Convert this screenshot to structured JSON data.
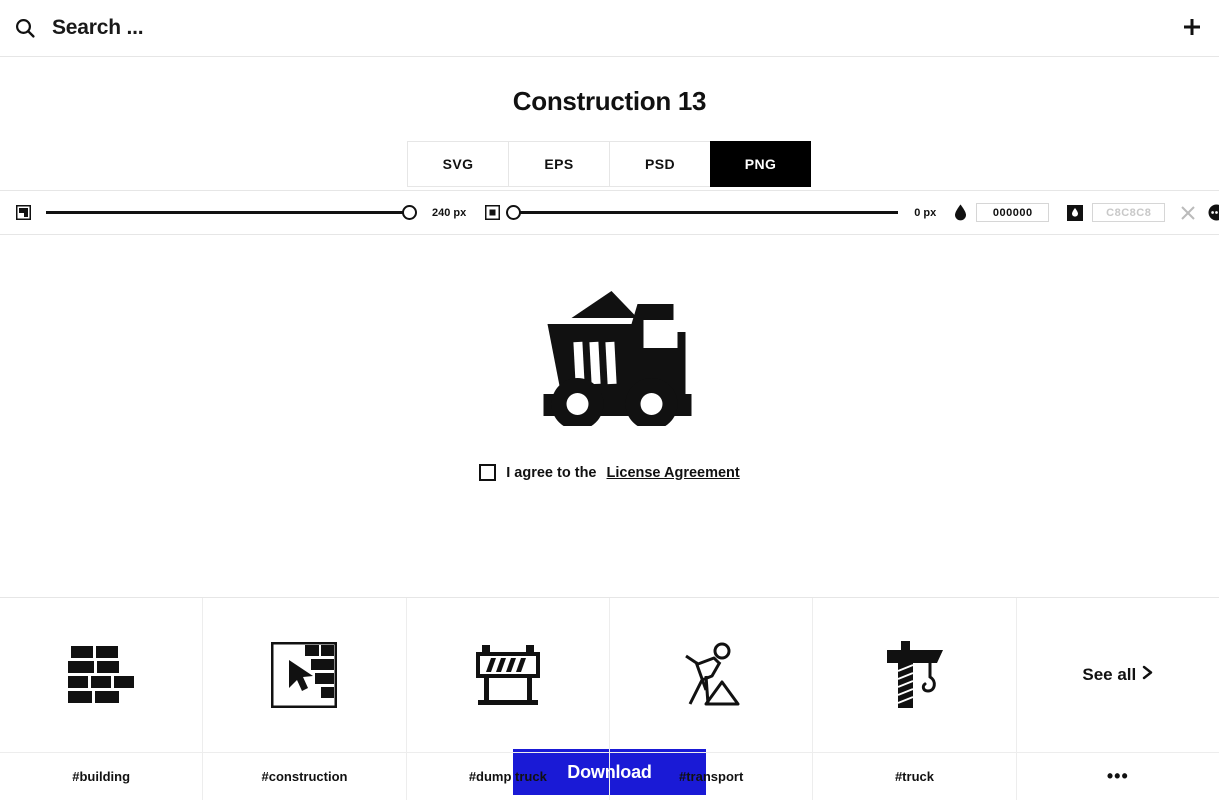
{
  "header": {
    "search_icon": "search-icon",
    "search_placeholder": "Search ...",
    "add_icon": "plus-icon"
  },
  "title": "Construction 13",
  "tabs": [
    {
      "label": "SVG",
      "active": false
    },
    {
      "label": "EPS",
      "active": false
    },
    {
      "label": "PSD",
      "active": false
    },
    {
      "label": "PNG",
      "active": true
    }
  ],
  "toolbar": {
    "size_icon": "icon-size-icon",
    "size_value": "240 px",
    "padding_icon": "icon-padding-icon",
    "padding_value": "0 px",
    "foreground_icon": "droplet-icon",
    "foreground_color": "000000",
    "background_icon": "droplet-filled-square-icon",
    "background_color": "C8C8C8",
    "clear_icon": "close-icon",
    "more_icon": "more-options-icon",
    "contrast_icon": "contrast-icon",
    "accent_black": "#000000",
    "muted_grey": "#c8c8c8"
  },
  "preview": {
    "icon_name": "dump-truck-icon",
    "agree_checkbox": "license-checkbox",
    "agree_text": "I agree to the",
    "license_link": "License Agreement",
    "download_label": "Download",
    "download_color": "#1a1ad6"
  },
  "tags": [
    {
      "label": "#building",
      "icon": "brick-wall-icon"
    },
    {
      "label": "#construction",
      "icon": "wall-cursor-icon"
    },
    {
      "label": "#dump truck",
      "icon": "road-barrier-icon"
    },
    {
      "label": "#transport",
      "icon": "worker-digging-icon"
    },
    {
      "label": "#truck",
      "icon": "crane-icon"
    }
  ],
  "see_all": {
    "label": "See all",
    "chevron": "chevron-right-icon",
    "dots": "•••"
  }
}
